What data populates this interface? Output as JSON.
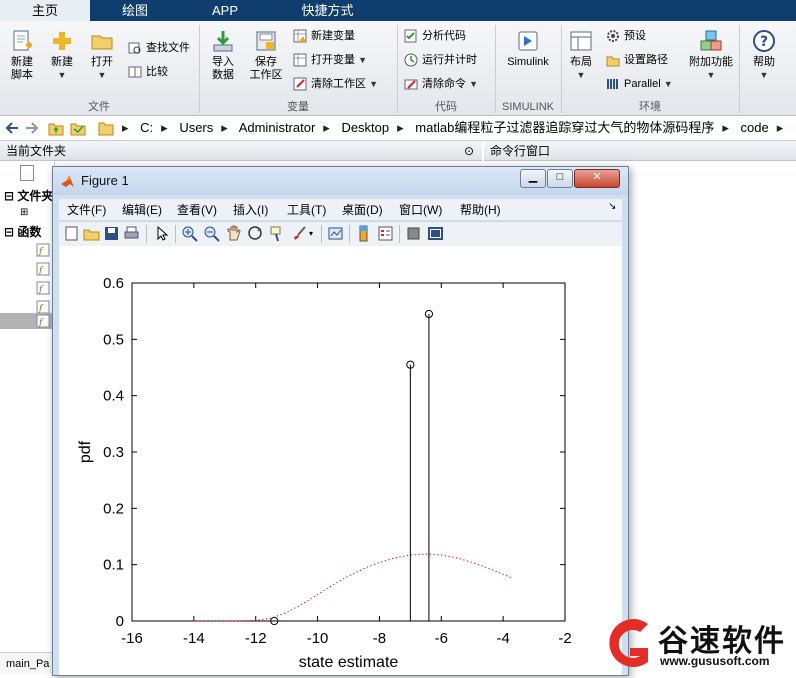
{
  "ribbon_tabs": [
    {
      "label": "主页",
      "active": true
    },
    {
      "label": "绘图",
      "active": false
    },
    {
      "label": "APP",
      "active": false
    },
    {
      "label": "快捷方式",
      "active": false
    }
  ],
  "ribbon": {
    "file_group": {
      "new_script": "新建\n脚本",
      "new": "新建",
      "open": "打开",
      "find_files": "查找文件",
      "compare": "比较",
      "label": "文件"
    },
    "variable_group": {
      "import_data": "导入\n数据",
      "save_workspace": "保存\n工作区",
      "new_variable": "新建变量",
      "open_variable": "打开变量",
      "clear_workspace": "清除工作区",
      "label": "变量"
    },
    "code_group": {
      "analyze_code": "分析代码",
      "run_and_time": "运行并计时",
      "clear_commands": "清除命令",
      "label": "代码"
    },
    "simulink_group": {
      "simulink": "Simulink",
      "label": "SIMULINK"
    },
    "environment_group": {
      "layout": "布局",
      "preferences": "预设",
      "set_path": "设置路径",
      "parallel": "Parallel",
      "addons": "附加功能",
      "label": "环境"
    },
    "help": "帮助"
  },
  "address_bar": {
    "path": [
      "C:",
      "Users",
      "Administrator",
      "Desktop",
      "matlab编程粒子过滤器追踪穿过大气的物体源码程序",
      "code"
    ]
  },
  "panels": {
    "current_folder": "当前文件夹",
    "command_window": "命令行窗口",
    "tree_folders": "文件夹",
    "tree_functions": "函数",
    "status_file": "main_Pa"
  },
  "figure": {
    "title": "Figure 1",
    "menu": [
      "文件(F)",
      "编辑(E)",
      "查看(V)",
      "插入(I)",
      "工具(T)",
      "桌面(D)",
      "窗口(W)",
      "帮助(H)"
    ],
    "toolbar_icons": [
      "new-figure-icon",
      "open-file-icon",
      "save-icon",
      "print-icon",
      "pointer-icon",
      "zoom-in-icon",
      "zoom-out-icon",
      "pan-icon",
      "rotate-3d-icon",
      "data-cursor-icon",
      "brush-icon",
      "link-plot-icon",
      "colorbar-icon",
      "legend-icon",
      "hide-plot-tools-icon",
      "show-plot-tools-icon"
    ]
  },
  "chart_data": {
    "type": "scatter",
    "title": "",
    "xlabel": "state estimate",
    "ylabel": "pdf",
    "xlim": [
      -16,
      -2
    ],
    "ylim": [
      0,
      0.6
    ],
    "xticks": [
      -16,
      -14,
      -12,
      -10,
      -8,
      -6,
      -4,
      -2
    ],
    "yticks": [
      0,
      0.1,
      0.2,
      0.3,
      0.4,
      0.5,
      0.6
    ],
    "grid": false,
    "series": [
      {
        "kind": "stem",
        "color": "#000000",
        "x": [
          -11.4,
          -7.0,
          -6.4
        ],
        "y": [
          0.0,
          0.455,
          0.545
        ]
      },
      {
        "kind": "dotted-line",
        "color": "#ff0000",
        "x": [
          -14.0,
          -13.5,
          -13.0,
          -12.5,
          -12.0,
          -11.5,
          -11.0,
          -10.5,
          -10.0,
          -9.5,
          -9.0,
          -8.5,
          -8.0,
          -7.5,
          -7.0,
          -6.5,
          -6.0,
          -5.5,
          -5.0,
          -4.5,
          -4.0,
          -3.7
        ],
        "y": [
          0.0,
          0.0,
          0.0,
          0.0,
          0.001,
          0.005,
          0.015,
          0.03,
          0.047,
          0.064,
          0.08,
          0.093,
          0.104,
          0.112,
          0.117,
          0.119,
          0.117,
          0.112,
          0.104,
          0.094,
          0.083,
          0.076
        ]
      }
    ]
  },
  "watermark": {
    "name": "谷速软件",
    "url": "www.gususoft.com"
  }
}
